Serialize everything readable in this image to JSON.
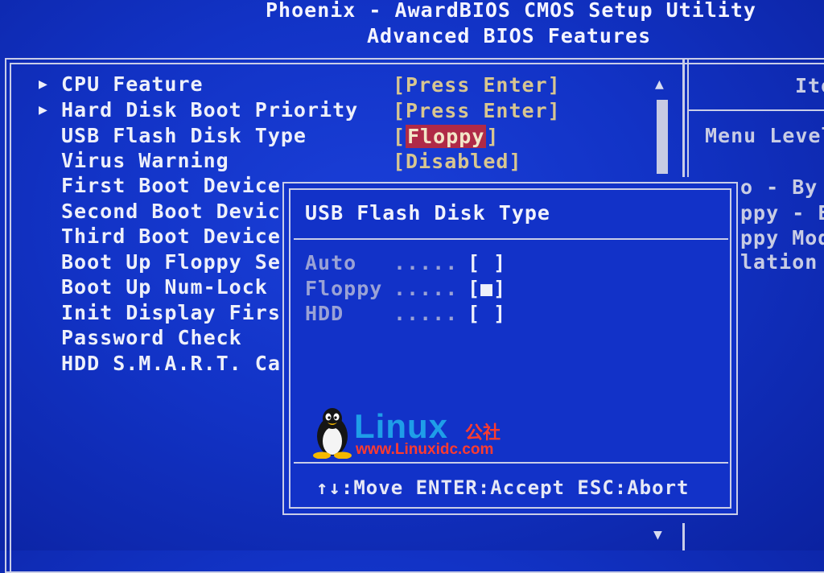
{
  "header": {
    "title": "Phoenix - AwardBIOS CMOS Setup Utility",
    "subtitle": "Advanced BIOS Features"
  },
  "menu": {
    "items": [
      {
        "label": "CPU Feature",
        "has_submenu": true,
        "value": "[Press Enter]"
      },
      {
        "label": "Hard Disk Boot Priority",
        "has_submenu": true,
        "value": "[Press Enter]"
      },
      {
        "label": "USB Flash Disk Type",
        "has_submenu": false,
        "value_open": "[",
        "value_selected": "Floppy",
        "value_close": "]"
      },
      {
        "label": "Virus Warning",
        "has_submenu": false,
        "value": "[Disabled]"
      },
      {
        "label": "First Boot Device",
        "has_submenu": false
      },
      {
        "label": "Second Boot Devic",
        "has_submenu": false
      },
      {
        "label": "Third Boot Device",
        "has_submenu": false
      },
      {
        "label": "Boot Up Floppy Se",
        "has_submenu": false
      },
      {
        "label": "Boot Up Num-Lock",
        "has_submenu": false
      },
      {
        "label": "Init Display Firs",
        "has_submenu": false
      },
      {
        "label": "Password Check",
        "has_submenu": false
      },
      {
        "label": "HDD S.M.A.R.T. Ca",
        "has_submenu": false
      }
    ],
    "submenu_arrow": "▶"
  },
  "scrollbar": {
    "up": "▲",
    "down": "▼"
  },
  "help_panel": {
    "title": "Ite",
    "menu_level": "Menu Level",
    "lines": [
      "o - By",
      "ppy - E",
      "ppy Mod",
      "lation"
    ]
  },
  "dialog": {
    "title": "USB Flash Disk Type",
    "options": [
      {
        "label": "Auto",
        "dots": ".....",
        "box": "[ ]"
      },
      {
        "label": "Floppy",
        "dots": ".....",
        "box": "[■]"
      },
      {
        "label": "HDD",
        "dots": ".....",
        "box": "[ ]"
      }
    ],
    "footer": "↑↓:Move ENTER:Accept ESC:Abort"
  },
  "watermark": {
    "brand": "Linux",
    "brand_cn": "公社",
    "url": "www.Linuxidc.com"
  }
}
